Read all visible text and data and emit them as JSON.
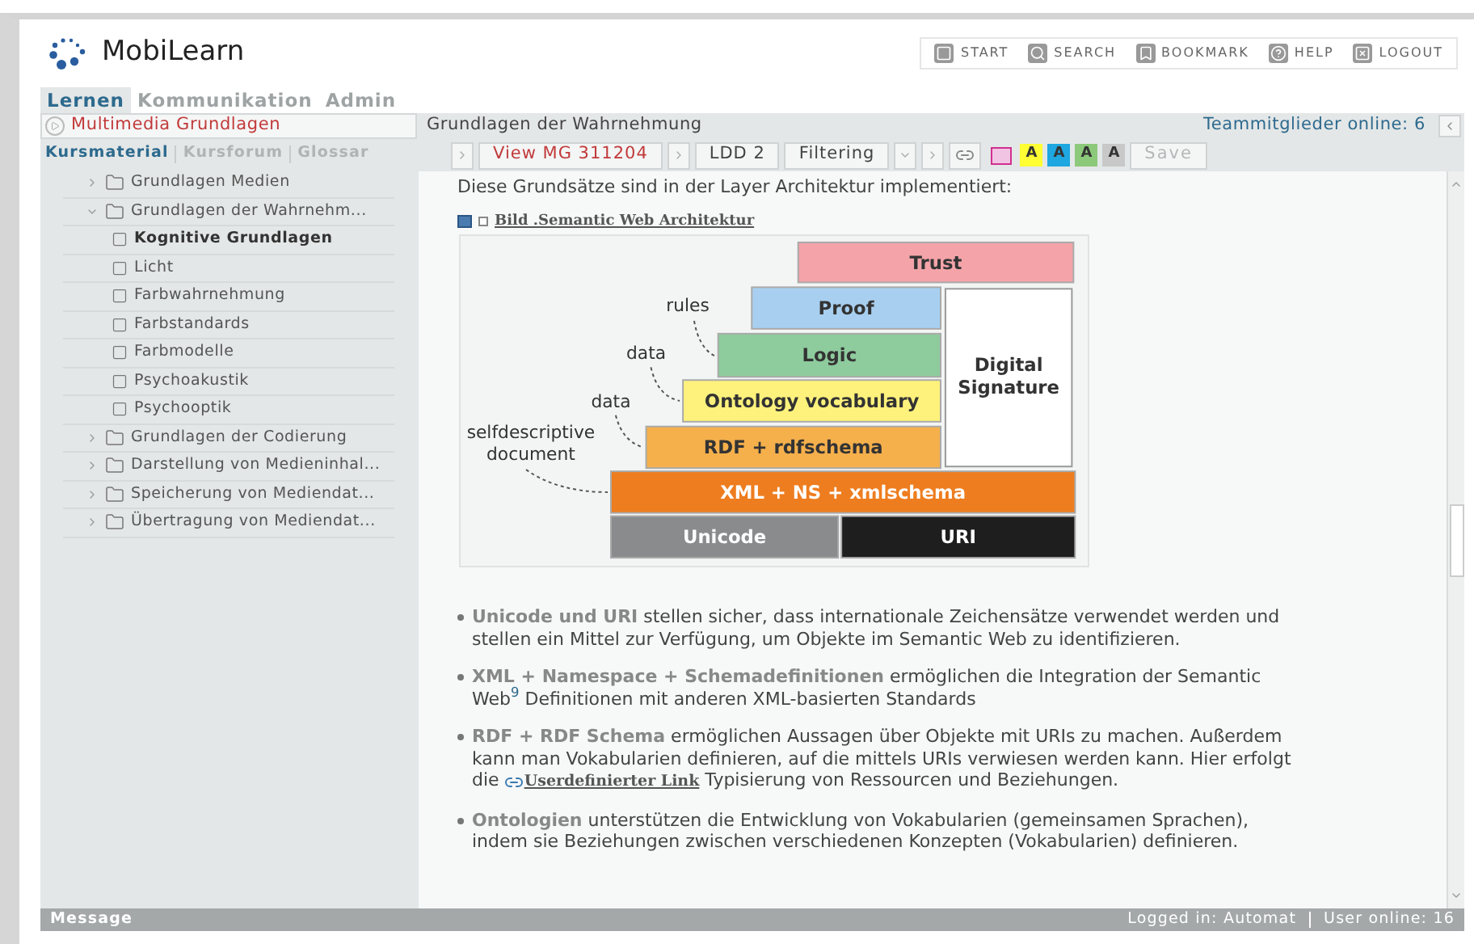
{
  "header": {
    "logo": "MobiLearn",
    "nav": [
      {
        "kind": "start",
        "label": "START"
      },
      {
        "kind": "search",
        "label": "SEARCH"
      },
      {
        "kind": "bookmark",
        "label": "BOOKMARK"
      },
      {
        "kind": "help",
        "label": "HELP"
      },
      {
        "kind": "logout",
        "label": "LOGOUT"
      }
    ]
  },
  "main_tabs": [
    {
      "label": "Lernen",
      "selected": true
    },
    {
      "label": "Kommunikation",
      "selected": false
    },
    {
      "label": "Admin",
      "selected": false
    }
  ],
  "course_title": "Multimedia Grundlagen",
  "sub_tabs": [
    {
      "label": "Kursmaterial",
      "selected": true
    },
    {
      "label": "Kursforum",
      "selected": false
    },
    {
      "label": "Glossar",
      "selected": false
    }
  ],
  "tree": [
    {
      "kind": "folder",
      "label": "Grundlagen Medien",
      "expanded": false
    },
    {
      "kind": "folder",
      "label": "Grundlagen der Wahrnehm...",
      "expanded": true,
      "children": [
        {
          "kind": "page",
          "label": "Kognitive Grundlagen",
          "selected": true
        },
        {
          "kind": "page",
          "label": "Licht",
          "selected": false
        },
        {
          "kind": "page",
          "label": "Farbwahrnehmung",
          "selected": false
        },
        {
          "kind": "page",
          "label": "Farbstandards",
          "selected": false
        },
        {
          "kind": "page",
          "label": "Farbmodelle",
          "selected": false
        },
        {
          "kind": "page",
          "label": "Psychoakustik",
          "selected": false
        },
        {
          "kind": "page",
          "label": "Psychooptik",
          "selected": false
        }
      ]
    },
    {
      "kind": "folder",
      "label": "Grundlagen der Codierung",
      "expanded": false
    },
    {
      "kind": "folder",
      "label": "Darstellung von Medieninhal...",
      "expanded": false
    },
    {
      "kind": "folder",
      "label": "Speicherung von Mediendat...",
      "expanded": false
    },
    {
      "kind": "folder",
      "label": "Übertragung von Mediendat...",
      "expanded": false
    }
  ],
  "breadcrumb": "Grundlagen der Wahrnehmung",
  "team_online": "Teammitglieder online: 6",
  "toolbar": {
    "view": "View MG 311204",
    "ldd": "LDD 2",
    "filter": "Filtering",
    "highlights": [
      {
        "label": "A",
        "color": "#ffff33"
      },
      {
        "label": "A",
        "color": "#1ea7e0"
      },
      {
        "label": "A",
        "color": "#8cc97a"
      },
      {
        "label": "A",
        "color": "#c8c8c8"
      }
    ],
    "save": {
      "label": "Save",
      "disabled": true
    }
  },
  "content": {
    "intro": "Diese Grundsätze sind in der Layer Architektur implementiert:",
    "figure_caption": "Bild .Semantic Web Architektur",
    "diagram": {
      "layers": [
        {
          "label": "Trust",
          "color": "#f4a4a9"
        },
        {
          "label": "Proof",
          "color": "#a8cff0"
        },
        {
          "label": "Digital Signature",
          "color": "#ffffff"
        },
        {
          "label": "Logic",
          "color": "#8ecb9d"
        },
        {
          "label": "Ontology vocabulary",
          "color": "#fff27c"
        },
        {
          "label": "RDF + rdfschema",
          "color": "#f5b04c"
        },
        {
          "label": "XML + NS + xmlschema",
          "color": "#ee7d1f"
        },
        {
          "label": "Unicode",
          "color": "#8a8b8d"
        },
        {
          "label": "URI",
          "color": "#1e1e1e"
        }
      ],
      "annotations": [
        "rules",
        "data",
        "data",
        "selfdescriptive document"
      ]
    },
    "bullets": [
      [
        {
          "kind": "text",
          "text": "**Unicode und URI** stellen sicher, dass internationale Zeichensätze verwendet werden und stellen ein Mittel zur Verfügung, um Objekte im Semantic Web zu identifizieren."
        }
      ],
      [
        {
          "kind": "text",
          "text": "**XML + Namespace + Schemadefinitionen** ermöglichen die Integration der Semantic Web$^{9}$  Definitionen mit anderen XML-basierten Standards"
        }
      ],
      [
        {
          "kind": "text",
          "text": "**RDF + RDF Schema** ermöglichen Aussagen über Objekte mit URIs zu machen. Außerdem kann man Vokabularien definieren, auf die mittels URIs verwiesen werden kann. Hier erfolgt die "
        },
        {
          "kind": "link",
          "text": "Userdefinierter Link"
        },
        {
          "kind": "text",
          "text": " Typisierung von Ressourcen und Beziehungen."
        }
      ],
      [
        {
          "kind": "text",
          "text": "**Ontologien** unterstützen die Entwicklung von Vokabularien (gemeinsamen Sprachen), indem sie Beziehungen zwischen verschiedenen Konzepten (Vokabularien) definieren."
        }
      ]
    ]
  },
  "footer": {
    "message": "Message",
    "logged_in": "Logged in: Automat",
    "users_online": "User online: 16"
  }
}
